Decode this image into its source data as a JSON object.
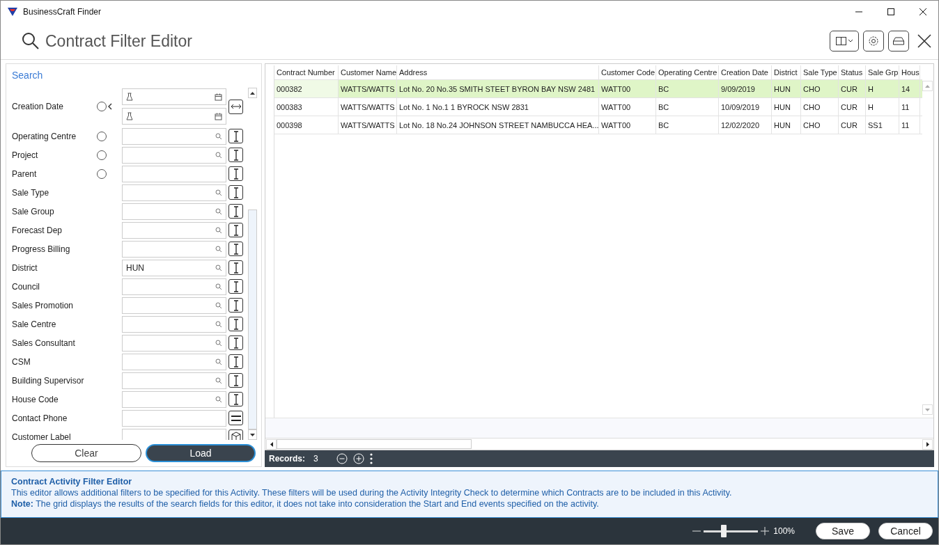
{
  "window": {
    "title": "BusinessCraft Finder"
  },
  "header": {
    "title": "Contract Filter Editor"
  },
  "search_panel": {
    "title": "Search",
    "fields": [
      {
        "label": "Creation Date",
        "kind": "daterange",
        "radio": {
          "selected": false
        },
        "operator": {
          "kind": "range"
        }
      },
      {
        "label": "Operating Centre",
        "kind": "lookup",
        "radio": {
          "selected": false
        },
        "operator": {
          "kind": "ibeam"
        }
      },
      {
        "label": "Project",
        "kind": "lookup",
        "radio": {
          "selected": false
        },
        "operator": {
          "kind": "ibeam"
        }
      },
      {
        "label": "Parent",
        "kind": "text",
        "radio": {
          "selected": false
        },
        "operator": {
          "kind": "ibeam"
        }
      },
      {
        "label": "Sale Type",
        "kind": "lookup",
        "operator": {
          "kind": "ibeam"
        }
      },
      {
        "label": "Sale Group",
        "kind": "lookup",
        "operator": {
          "kind": "ibeam"
        }
      },
      {
        "label": "Forecast Dep",
        "kind": "lookup",
        "operator": {
          "kind": "ibeam"
        }
      },
      {
        "label": "Progress Billing",
        "kind": "lookup",
        "operator": {
          "kind": "ibeam"
        }
      },
      {
        "label": "District",
        "kind": "lookup",
        "value": "HUN",
        "operator": {
          "kind": "ibeam"
        }
      },
      {
        "label": "Council",
        "kind": "lookup",
        "operator": {
          "kind": "ibeam"
        }
      },
      {
        "label": "Sales Promotion",
        "kind": "lookup",
        "operator": {
          "kind": "ibeam"
        }
      },
      {
        "label": "Sale Centre",
        "kind": "lookup",
        "operator": {
          "kind": "ibeam"
        }
      },
      {
        "label": "Sales Consultant",
        "kind": "lookup",
        "operator": {
          "kind": "ibeam"
        }
      },
      {
        "label": "CSM",
        "kind": "lookup",
        "operator": {
          "kind": "ibeam"
        }
      },
      {
        "label": "Building Supervisor",
        "kind": "lookup",
        "operator": {
          "kind": "ibeam"
        }
      },
      {
        "label": "House Code",
        "kind": "lookup",
        "operator": {
          "kind": "ibeam"
        }
      },
      {
        "label": "Contact Phone",
        "kind": "text",
        "operator": {
          "kind": "equals"
        }
      },
      {
        "label": "Customer Label",
        "kind": "text",
        "operator": {
          "kind": "cube"
        }
      }
    ],
    "buttons": [
      {
        "label": "Clear",
        "kind": "secondary"
      },
      {
        "label": "Load",
        "kind": "primary"
      }
    ]
  },
  "table": {
    "columns": [
      "Contract Number",
      "Customer Name",
      "Address",
      "Customer Code",
      "Operating Centre",
      "Creation Date",
      "District",
      "Sale Type",
      "Status",
      "Sale Grp",
      "Hous"
    ],
    "rows": [
      {
        "selected": true,
        "cells": [
          "000382",
          "WATTS/WATTS",
          "Lot No. 20 No.35 SMITH STEET BYRON BAY NSW 2481",
          "WATT00",
          "BC",
          "9/09/2019",
          "HUN",
          "CHO",
          "CUR",
          "H",
          "14"
        ]
      },
      {
        "selected": false,
        "cells": [
          "000383",
          "WATTS/WATTS",
          "Lot No. 1 No.1 1 BYROCK NSW 2831",
          "WATT00",
          "BC",
          "10/09/2019",
          "HUN",
          "CHO",
          "CUR",
          "H",
          "11"
        ]
      },
      {
        "selected": false,
        "cells": [
          "000398",
          "WATTS/WATTS",
          "Lot No. 18 No.24 JOHNSON STREET NAMBUCCA HEA...",
          "WATT00",
          "BC",
          "12/02/2020",
          "HUN",
          "CHO",
          "CUR",
          "SS1",
          "11"
        ]
      }
    ]
  },
  "records": {
    "label": "Records:",
    "count": "3"
  },
  "info": {
    "title": "Contract Activity Filter Editor",
    "text": "This editor allows additional filters to be specified for this Activity. These filters will be used during the Activity Integrity Check to determine which Contracts are to be included in this Activity.",
    "note": "**Note:** The grid displays the results of the search fields for this editor, it does not take into consideration the Start and End events specified on the activity."
  },
  "footer": {
    "zoom": {
      "level": 0.37,
      "reading": "100%"
    },
    "buttons": [
      "Save",
      "Cancel"
    ]
  }
}
